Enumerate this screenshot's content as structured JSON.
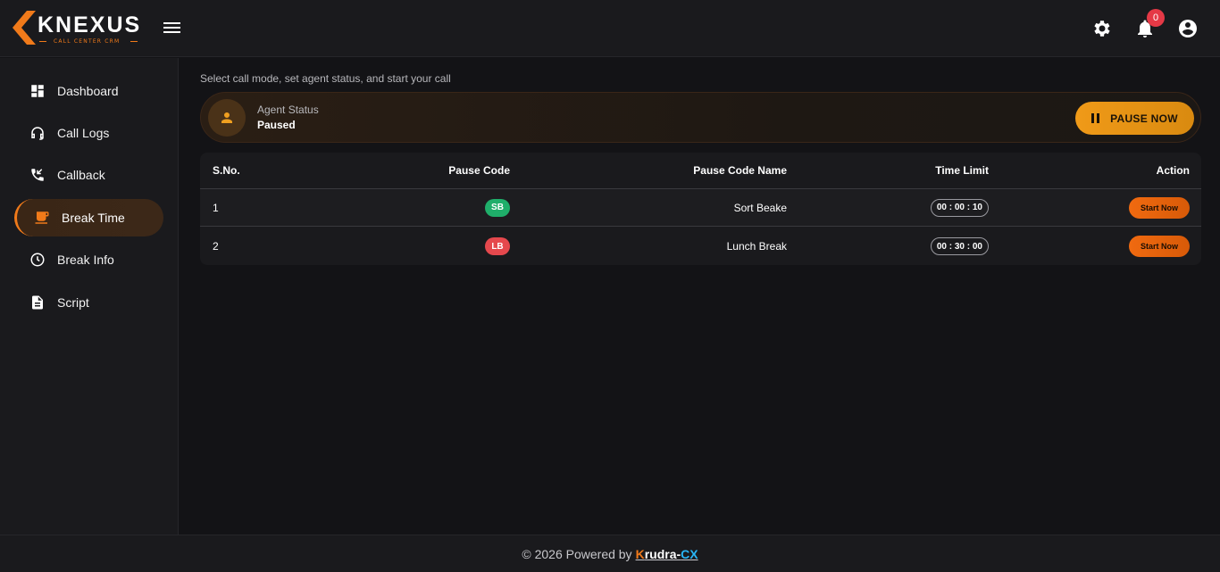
{
  "brand": {
    "name": "KNEXUS",
    "tagline": "CALL CENTER CRM",
    "accent": "#f07a1a"
  },
  "header": {
    "icons": [
      "menu-icon",
      "gear-icon",
      "bell-icon",
      "account-icon"
    ],
    "notification_count": "0"
  },
  "sidebar": {
    "items": [
      {
        "label": "Dashboard",
        "icon": "dashboard-icon"
      },
      {
        "label": "Call Logs",
        "icon": "headset-icon"
      },
      {
        "label": "Callback",
        "icon": "phone-callback-icon"
      },
      {
        "label": "Break Time",
        "icon": "coffee-icon",
        "active": true
      },
      {
        "label": "Break Info",
        "icon": "clock-icon"
      },
      {
        "label": "Script",
        "icon": "document-icon"
      }
    ]
  },
  "main": {
    "subtitle": "Select call mode, set agent status, and start your call",
    "status": {
      "label": "Agent Status",
      "value": "Paused",
      "button_label": "PAUSE NOW"
    },
    "table": {
      "headers": [
        "S.No.",
        "Pause Code",
        "Pause Code Name",
        "Time Limit",
        "Action"
      ],
      "rows": [
        {
          "sno": "1",
          "code": "SB",
          "code_color": "#1fae6a",
          "name": "Sort Beake",
          "time": "00 : 00 : 10",
          "action": "Start Now"
        },
        {
          "sno": "2",
          "code": "LB",
          "code_color": "#e5484d",
          "name": "Lunch Break",
          "time": "00 : 30 : 00",
          "action": "Start Now"
        }
      ]
    }
  },
  "footer": {
    "prefix": "© 2026 Powered by",
    "brand_k": "K",
    "brand_mid": "rudra-",
    "brand_cx": "CX"
  }
}
